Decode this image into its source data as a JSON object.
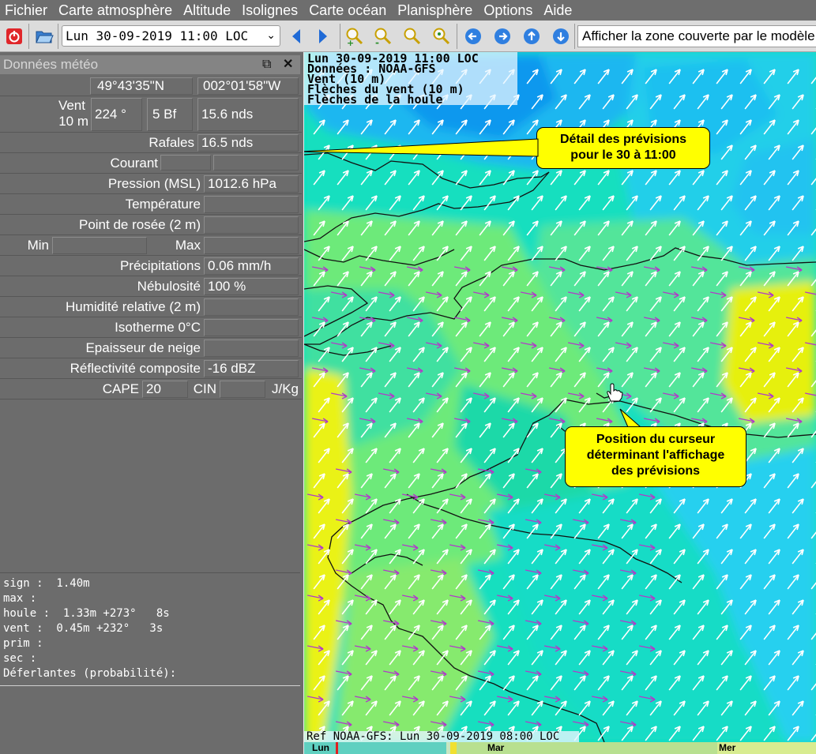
{
  "menu": [
    "Fichier",
    "Carte atmosphère",
    "Altitude",
    "Isolignes",
    "Carte océan",
    "Planisphère",
    "Options",
    "Aide"
  ],
  "toolbar": {
    "date_value": "Lun 30-09-2019 11:00 LOC",
    "zone_button_label": "Afficher la zone couverte par le modèle"
  },
  "panel": {
    "title": "Données météo",
    "lat": "49°43'35\"N",
    "lon": "002°01'58\"W",
    "vent_label": "Vent",
    "vent_sub": "10 m",
    "vent_dir": "224 °",
    "vent_bf": "5 Bf",
    "vent_speed": "15.6  nds",
    "rafales_label": "Rafales",
    "rafales_value": "16.5  nds",
    "courant_label": "Courant",
    "pression_label": "Pression (MSL)",
    "pression_value": "1012.6 hPa",
    "temperature_label": "Température",
    "rosee_label": "Point de rosée (2 m)",
    "min_label": "Min",
    "max_label": "Max",
    "precip_label": "Précipitations",
    "precip_value": "0.06 mm/h",
    "nebul_label": "Nébulosité",
    "nebul_value": "100 %",
    "humid_label": "Humidité relative (2 m)",
    "iso_label": "Isotherme 0°C",
    "neige_label": "Epaisseur de neige",
    "reflect_label": "Réflectivité composite",
    "reflect_value": "-16 dBZ",
    "cape_label": "CAPE",
    "cape_value": "20",
    "cin_label": "CIN",
    "cin_unit": "J/Kg"
  },
  "waves": [
    "sign :  1.40m",
    "max :",
    "houle :  1.33m +273°   8s",
    "vent :  0.45m +232°   3s",
    "prim :",
    "sec :",
    "Déferlantes (probabilité):"
  ],
  "map": {
    "header": [
      "Lun 30-09-2019 11:00 LOC",
      "Données : NOAA-GFS",
      "Vent (10 m)",
      "Flèches du vent (10 m)",
      "Flèches de la houle"
    ],
    "ref": "Ref NOAA-GFS: Lun 30-09-2019 08:00 LOC",
    "callout_forecast": [
      "Détail des prévisions",
      "pour le 30 à 11:00"
    ],
    "callout_cursor": [
      "Position du curseur",
      "déterminant l'affichage",
      "des prévisions"
    ]
  },
  "timeline": [
    "Lun",
    "Mar",
    "Mer"
  ],
  "colors": {
    "menubar": "#6e6e6e",
    "panel": "#6c6c6c",
    "callout": "#ffff00",
    "sea_cyan": "#13dfbf",
    "wave_arrow": "#b03cc8"
  }
}
